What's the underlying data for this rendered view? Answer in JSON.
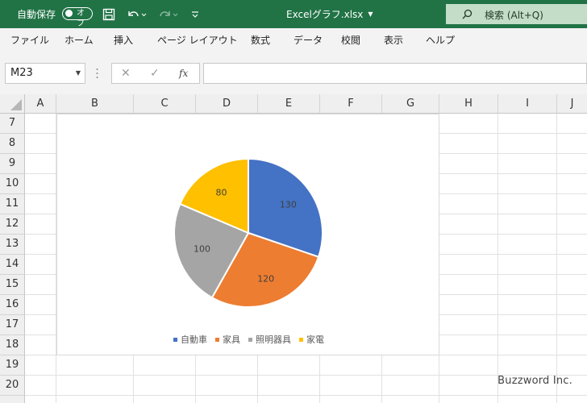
{
  "titlebar": {
    "autosave_label": "自動保存",
    "autosave_state": "オフ",
    "filename": "Excelグラフ.xlsx",
    "search_placeholder": "検索 (Alt+Q)"
  },
  "ribbon": {
    "tabs": [
      "ファイル",
      "ホーム",
      "挿入",
      "ページ レイアウト",
      "数式",
      "データ",
      "校閲",
      "表示",
      "ヘルプ"
    ]
  },
  "formula_bar": {
    "name_box": "M23",
    "fx_label": "fx",
    "formula": ""
  },
  "sheet": {
    "columns": [
      "A",
      "B",
      "C",
      "D",
      "E",
      "F",
      "G",
      "H",
      "I",
      "J"
    ],
    "rows": [
      "7",
      "8",
      "9",
      "10",
      "11",
      "12",
      "13",
      "14",
      "15",
      "16",
      "17",
      "18",
      "19",
      "20"
    ]
  },
  "chart_data": {
    "type": "pie",
    "categories": [
      "自動車",
      "家具",
      "照明器具",
      "家電"
    ],
    "values": [
      130,
      120,
      100,
      80
    ],
    "colors": [
      "#4472c4",
      "#ed7d31",
      "#a5a5a5",
      "#ffc000"
    ],
    "legend_position": "bottom",
    "data_labels": true
  },
  "watermark": "Buzzword Inc."
}
